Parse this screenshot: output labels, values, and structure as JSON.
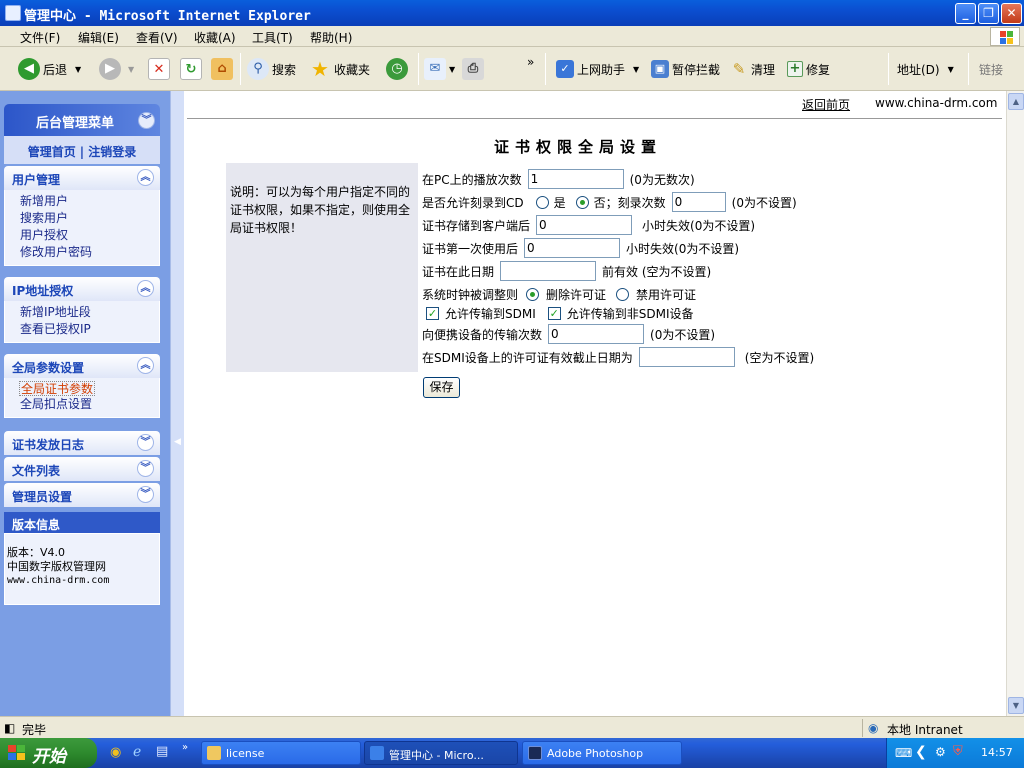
{
  "window": {
    "title": "管理中心 - Microsoft Internet Explorer"
  },
  "menubar": [
    "文件(F)",
    "编辑(E)",
    "查看(V)",
    "收藏(A)",
    "工具(T)",
    "帮助(H)"
  ],
  "toolbar": {
    "back": "后退",
    "search": "搜索",
    "favorites": "收藏夹",
    "more": "»",
    "helper": "上网助手",
    "block": "暂停拦截",
    "clean": "清理",
    "repair": "修复",
    "address": "地址(D)",
    "links": "链接"
  },
  "sidebar": {
    "header": "后台管理菜单",
    "home": "管理首页",
    "separator": "|",
    "logout": "注销登录",
    "groups": [
      {
        "title": "用户管理",
        "items": [
          "新增用户",
          "搜索用户",
          "用户授权",
          "修改用户密码"
        ]
      },
      {
        "title": "IP地址授权",
        "items": [
          "新增IP地址段",
          "查看已授权IP"
        ]
      },
      {
        "title": "全局参数设置",
        "items": [
          "全局证书参数",
          "全局扣点设置"
        ]
      },
      {
        "title": "证书发放日志",
        "items": []
      },
      {
        "title": "文件列表",
        "items": []
      },
      {
        "title": "管理员设置",
        "items": []
      }
    ],
    "version_title": "版本信息",
    "version_lines": [
      "版本：V4.0",
      "中国数字版权管理网",
      "www.china-drm.com"
    ]
  },
  "content": {
    "back_link": "返回前页",
    "site": "www.china-drm.com",
    "title": "证书权限全局设置",
    "note": "说明：可以为每个用户指定不同的证书权限，如果不指定，则使用全局证书权限！",
    "fields": {
      "play_label": "在PC上的播放次数",
      "play_value": "1",
      "play_hint": "(0为无数次)",
      "cd_label": "是否允许刻录到CD",
      "yes": "是",
      "no": "否；刻录次数",
      "burn_value": "0",
      "burn_hint": "(0为不设置)",
      "store_label": "证书存储到客户端后",
      "store_value": "0",
      "store_hint": "小时失效(0为不设置)",
      "first_label": "证书第一次使用后",
      "first_value": "0",
      "first_hint": "小时失效(0为不设置)",
      "date_label": "证书在此日期",
      "date_value": "",
      "date_hint": "前有效 (空为不设置)",
      "clock_label": "系统时钟被调整则",
      "clock_opt1": "删除许可证",
      "clock_opt2": "禁用许可证",
      "sdmi_label": "允许传输到SDMI",
      "nonsdmi_label": "允许传输到非SDMI设备",
      "portable_label": "向便携设备的传输次数",
      "portable_value": "0",
      "portable_hint": "(0为不设置)",
      "expire_label": "在SDMI设备上的许可证有效截止日期为",
      "expire_value": "",
      "expire_hint": "(空为不设置)"
    },
    "save": "保存"
  },
  "status": {
    "left": "完毕",
    "right": "本地 Intranet"
  },
  "taskbar": {
    "start": "开始",
    "tasks": [
      "license",
      "管理中心 - Micro...",
      "Adobe Photoshop"
    ],
    "time": "14:57"
  },
  "colors": {
    "title_bar": "#0b4ed0",
    "sidebar_bg": "#7b9ee4",
    "sidebar_link": "#1c46b8",
    "selected_item": "#d23d00",
    "note_bg": "#e6e7ef",
    "taskbar": "#245edb",
    "start_button": "#2e8a2e"
  }
}
